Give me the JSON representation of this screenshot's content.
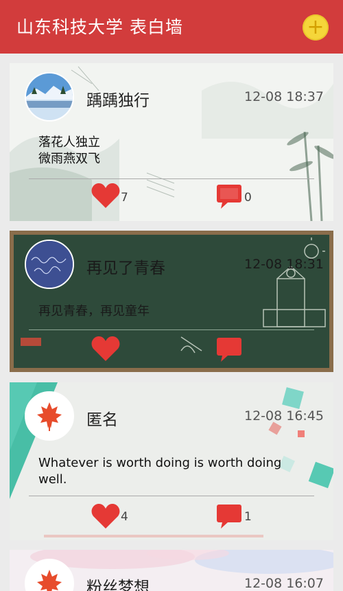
{
  "header": {
    "title": "山东科技大学 表白墙",
    "add_icon": "plus-icon",
    "bar_color": "#d23c3c",
    "add_color": "#f5d63a"
  },
  "posts": [
    {
      "username": "踽踽独行",
      "time": "12-08 18:37",
      "content": "落花人独立\n微雨燕双飞",
      "likes": "7",
      "comments": "0"
    },
    {
      "username": "再见了青春",
      "time": "12-08 18:31",
      "content": "再见青春，再见童年",
      "likes": "",
      "comments": ""
    },
    {
      "username": "匿名",
      "time": "12-08 16:45",
      "content": "Whatever is worth doing is worth doing well.",
      "likes": "4",
      "comments": "1"
    },
    {
      "username": "粉丝梦想",
      "time": "12-08 16:07",
      "content": "",
      "likes": "",
      "comments": ""
    }
  ],
  "icons": {
    "like": "heart-icon",
    "comment": "comment-icon",
    "anon_avatar": "maple-leaf-icon"
  }
}
